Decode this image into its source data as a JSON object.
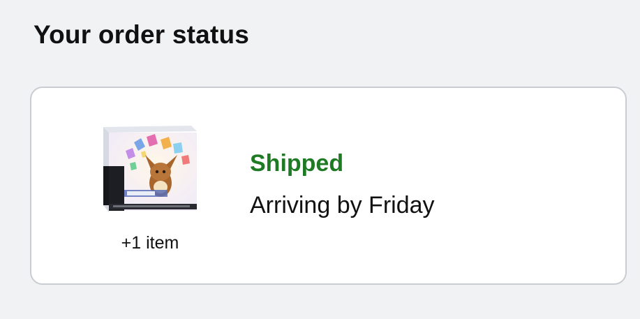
{
  "page": {
    "title": "Your order status"
  },
  "order": {
    "status": "Shipped",
    "arrival": "Arriving by Friday",
    "extra_items": "+1 item",
    "thumbnail_icon": "product-box-image",
    "status_color": "#1e7a23"
  }
}
